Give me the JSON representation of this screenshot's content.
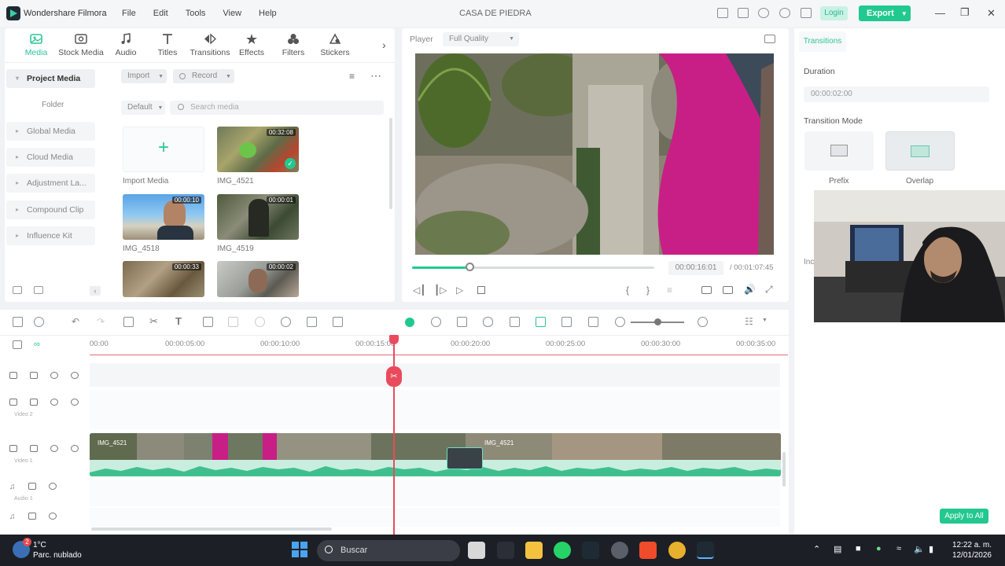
{
  "app": {
    "name": "Wondershare Filmora",
    "project_title": "CASA DE PIEDRA",
    "menu": [
      "File",
      "Edit",
      "Tools",
      "View",
      "Help"
    ],
    "login_label": "Login",
    "export_label": "Export"
  },
  "toolbar_tabs": [
    {
      "label": "Media",
      "icon": "media-icon",
      "active": true
    },
    {
      "label": "Stock Media",
      "icon": "stock-media-icon"
    },
    {
      "label": "Audio",
      "icon": "music-note-icon"
    },
    {
      "label": "Titles",
      "icon": "titles-icon"
    },
    {
      "label": "Transitions",
      "icon": "transitions-icon"
    },
    {
      "label": "Effects",
      "icon": "effects-icon"
    },
    {
      "label": "Filters",
      "icon": "filters-icon"
    },
    {
      "label": "Stickers",
      "icon": "stickers-icon"
    }
  ],
  "sidebar": {
    "items": [
      {
        "label": "Project Media",
        "active": true
      },
      {
        "label": "Folder",
        "child": true
      },
      {
        "label": "Global Media"
      },
      {
        "label": "Cloud Media"
      },
      {
        "label": "Adjustment La..."
      },
      {
        "label": "Compound Clip"
      },
      {
        "label": "Influence Kit"
      }
    ]
  },
  "media": {
    "import_label": "Import",
    "record_label": "Record",
    "sort_label": "Default",
    "search_placeholder": "Search media",
    "import_tile_label": "Import Media",
    "items": [
      {
        "name": "IMG_4521",
        "duration": "00:32:08",
        "checked": true
      },
      {
        "name": "IMG_4518",
        "duration": "00:00:10"
      },
      {
        "name": "IMG_4519",
        "duration": "00:00:01"
      },
      {
        "name": "",
        "duration": "00:00:33"
      },
      {
        "name": "",
        "duration": "00:00:02"
      }
    ]
  },
  "player": {
    "label": "Player",
    "quality": "Full Quality",
    "current_time": "00:00:16:01",
    "total_time": "/ 00:01:07:45",
    "progress": 0.24
  },
  "transition_panel": {
    "tab_label": "Transitions",
    "duration_label": "Duration",
    "duration_value": "00:00:02:00",
    "mode_label": "Transition Mode",
    "modes": [
      {
        "label": "Prefix",
        "selected": false
      },
      {
        "label": "Overlap",
        "selected": true
      }
    ],
    "partial_label": "Inc",
    "apply_all_label": "Apply to All"
  },
  "timeline": {
    "ruler": [
      "00:00",
      "00:00:05:00",
      "00:00:10:00",
      "00:00:15:00",
      "00:00:20:00",
      "00:00:25:00",
      "00:00:30:00",
      "00:00:35:00"
    ],
    "tracks": [
      {
        "id": "3",
        "type": "video",
        "name": ""
      },
      {
        "id": "2",
        "type": "video",
        "name": "Video 2"
      },
      {
        "id": "1",
        "type": "video",
        "name": "Video 1"
      },
      {
        "id": "1",
        "type": "audio",
        "name": "Audio 1"
      },
      {
        "id": "2",
        "type": "audio",
        "name": ""
      }
    ],
    "clip_labels": [
      "IMG_4521",
      "IMG_4521"
    ]
  },
  "taskbar": {
    "temperature": "1°C",
    "weather": "Parc. nublado",
    "weather_badge": "2",
    "search_label": "Buscar",
    "time": "12:22 a. m.",
    "date": "12/01/2026"
  }
}
